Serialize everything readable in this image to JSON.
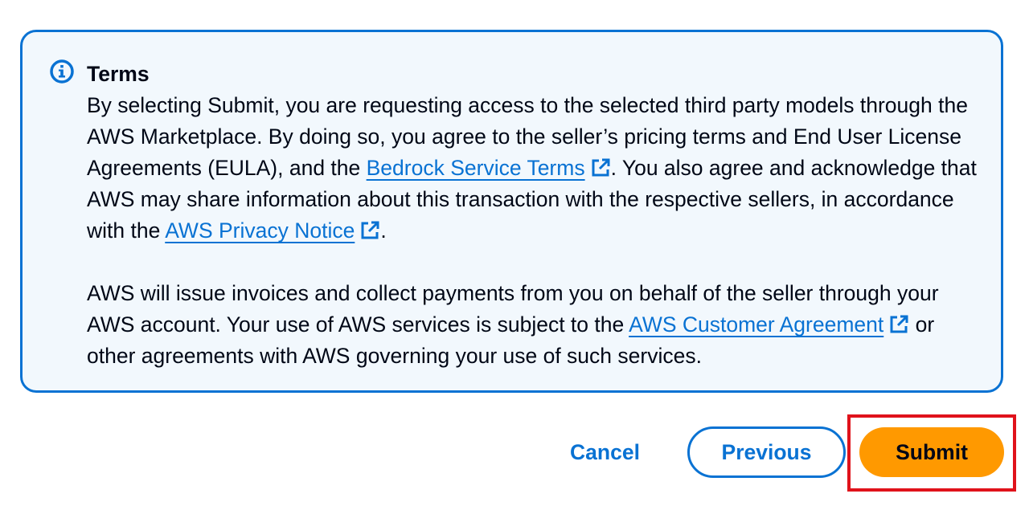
{
  "alert": {
    "icon": "info-circle-icon",
    "title": "Terms",
    "p1_a": "By selecting Submit, you are requesting access to the selected third party models through the AWS Marketplace. By doing so, you agree to the seller’s pricing terms and End User License Agreements (EULA), and the ",
    "link_bedrock": "Bedrock Service Terms",
    "p1_b": ". You also agree and acknowledge that AWS may share information about this transaction with the respective sellers, in accordance with the ",
    "link_privacy": "AWS Privacy Notice",
    "p1_c": ".",
    "p2_a": "AWS will issue invoices and collect payments from you on behalf of the seller through your AWS account. Your use of AWS services is subject to the ",
    "link_customer": "AWS Customer Agreement",
    "p2_b": " or other agreements with AWS governing your use of such services."
  },
  "actions": {
    "cancel_label": "Cancel",
    "previous_label": "Previous",
    "submit_label": "Submit"
  },
  "colors": {
    "accent": "#0972d3",
    "alert_bg": "#f2f8fd",
    "primary_button": "#ff9900",
    "highlight": "#e0121b"
  }
}
